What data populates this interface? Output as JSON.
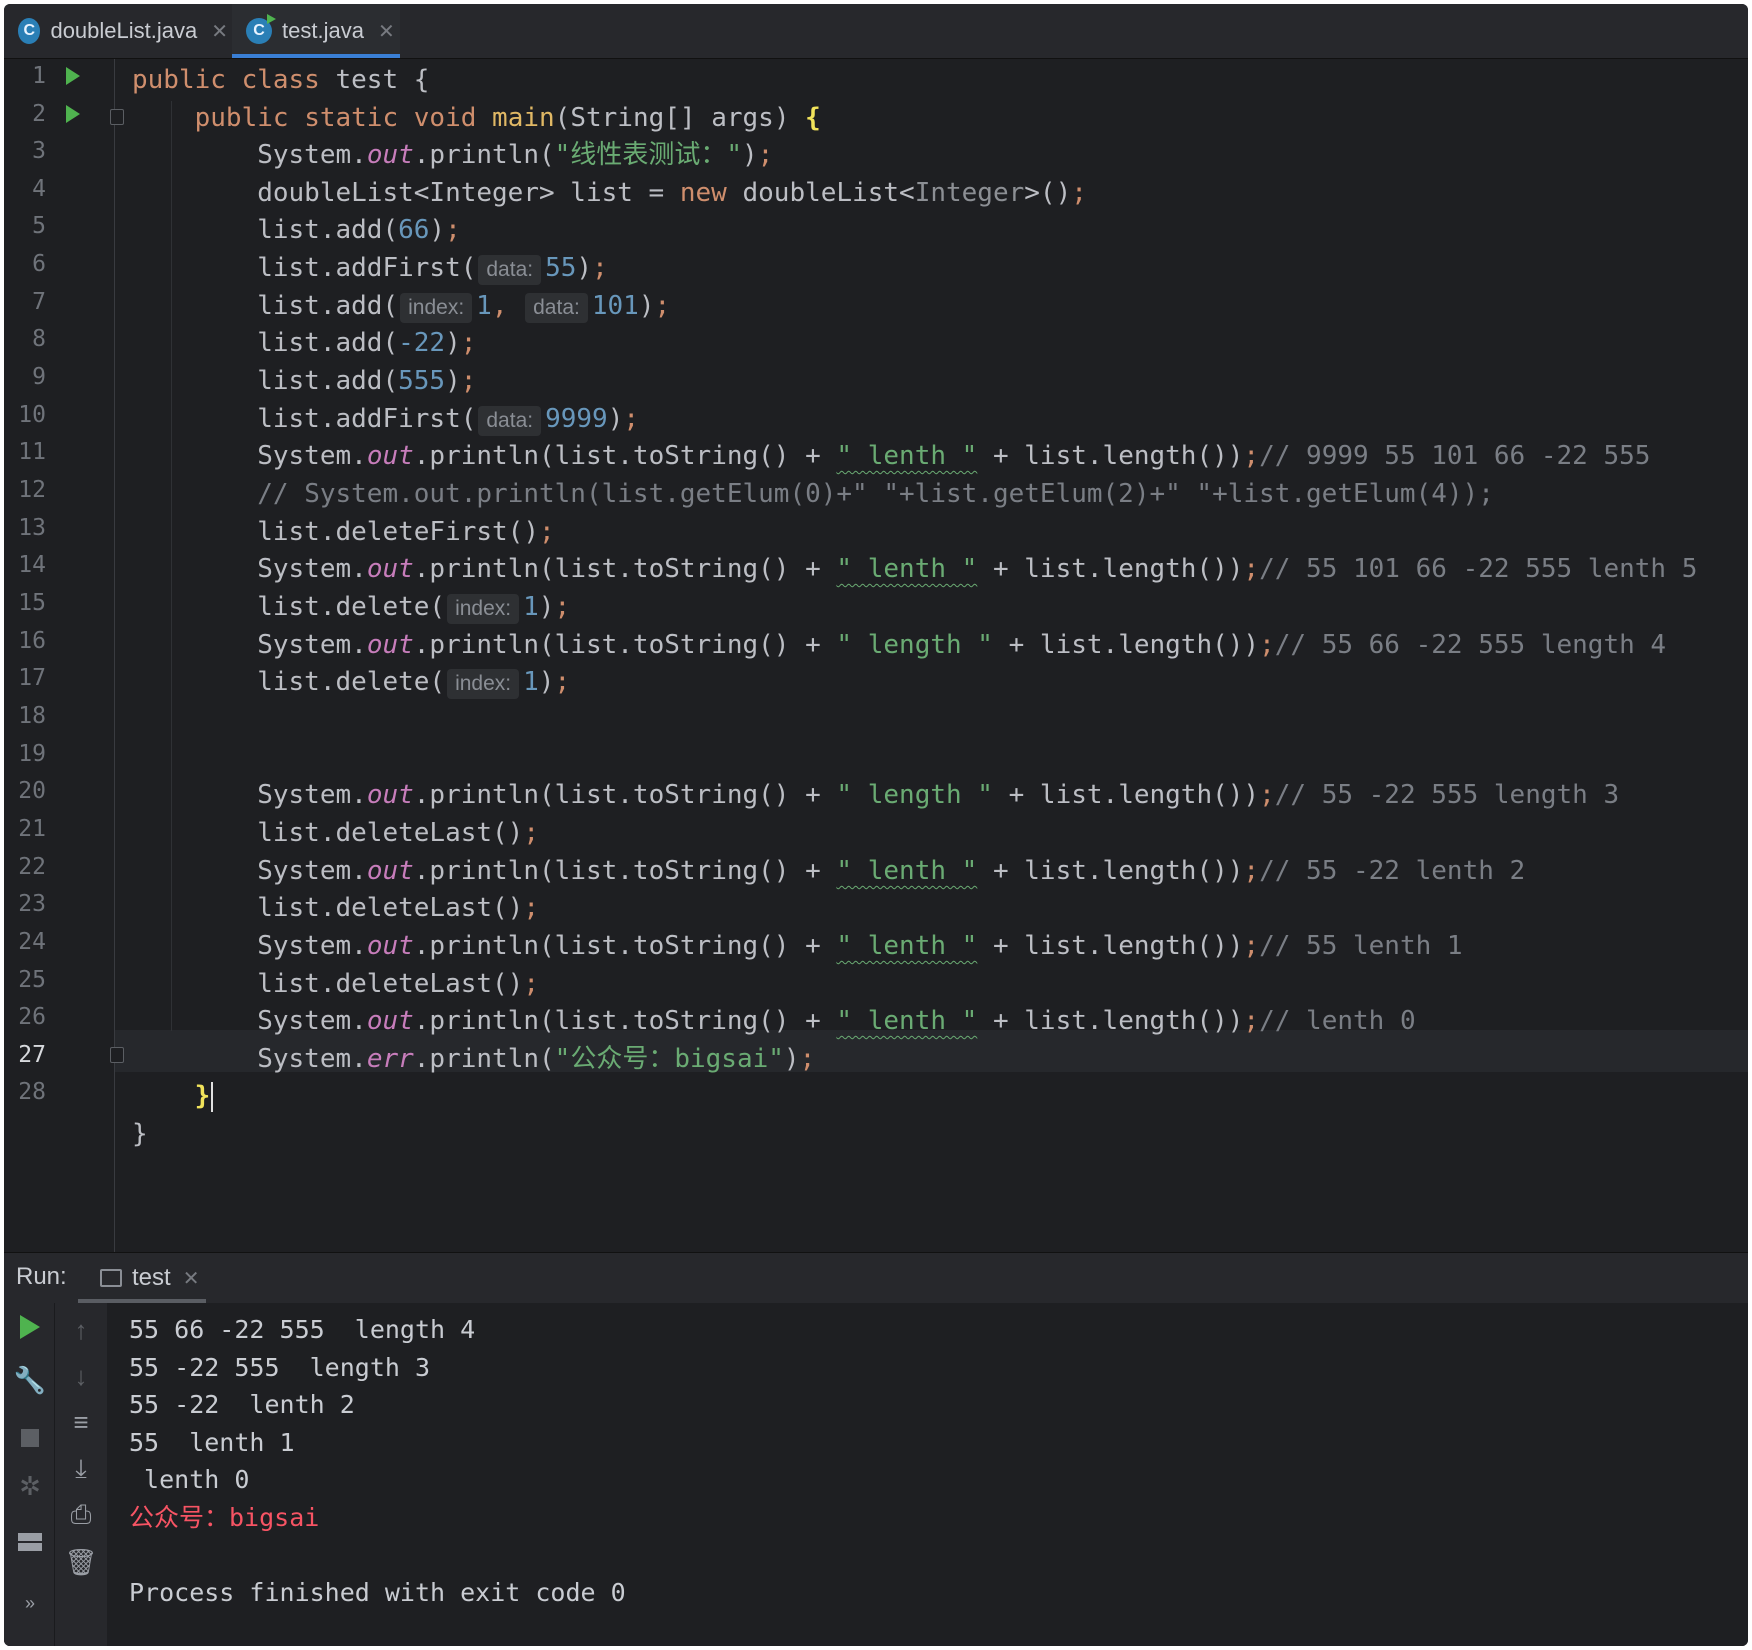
{
  "tabs": [
    {
      "label": "doubleList.java",
      "icon": "java-class-icon",
      "active": false
    },
    {
      "label": "test.java",
      "icon": "java-class-run-icon",
      "active": true
    }
  ],
  "editor": {
    "line_numbers": [
      "1",
      "2",
      "3",
      "4",
      "5",
      "6",
      "7",
      "8",
      "9",
      "10",
      "11",
      "12",
      "13",
      "14",
      "15",
      "16",
      "17",
      "18",
      "19",
      "20",
      "21",
      "22",
      "23",
      "24",
      "25",
      "26",
      "27",
      "28"
    ],
    "current_line": "27",
    "hints": {
      "data": "data:",
      "index": "index:"
    },
    "strings": {
      "test_label": "\"线性表测试：\"",
      "lenth": "\" lenth \"",
      "length": "\" length \"",
      "wechat": "\"公众号：bigsai\""
    },
    "comments": {
      "l11": "// 9999 55 101 66 -22 555",
      "l12": "// System.out.println(list.getElum(0)+\" \"+list.getElum(2)+\" \"+list.getElum(4));",
      "l14": "// 55 101 66 -22 555 lenth 5",
      "l16": "// 55 66 -22 555 length 4",
      "l19": "// 55 -22 555 length 3",
      "l21": "// 55 -22 lenth 2",
      "l23": "// 55 lenth 1",
      "l25": "// lenth 0"
    },
    "numbers": {
      "n66": "66",
      "n55": "55",
      "n1": "1",
      "n101": "101",
      "nm22": "-22",
      "n555": "555",
      "n9999": "9999"
    }
  },
  "run": {
    "label": "Run:",
    "tab": "test",
    "output": [
      "55 66 -22 555  length 4",
      "55 -22 555  length 3",
      "55 -22  lenth 2",
      "55  lenth 1",
      " lenth 0"
    ],
    "error_output": "公众号：bigsai",
    "exit": "Process finished with exit code 0"
  }
}
